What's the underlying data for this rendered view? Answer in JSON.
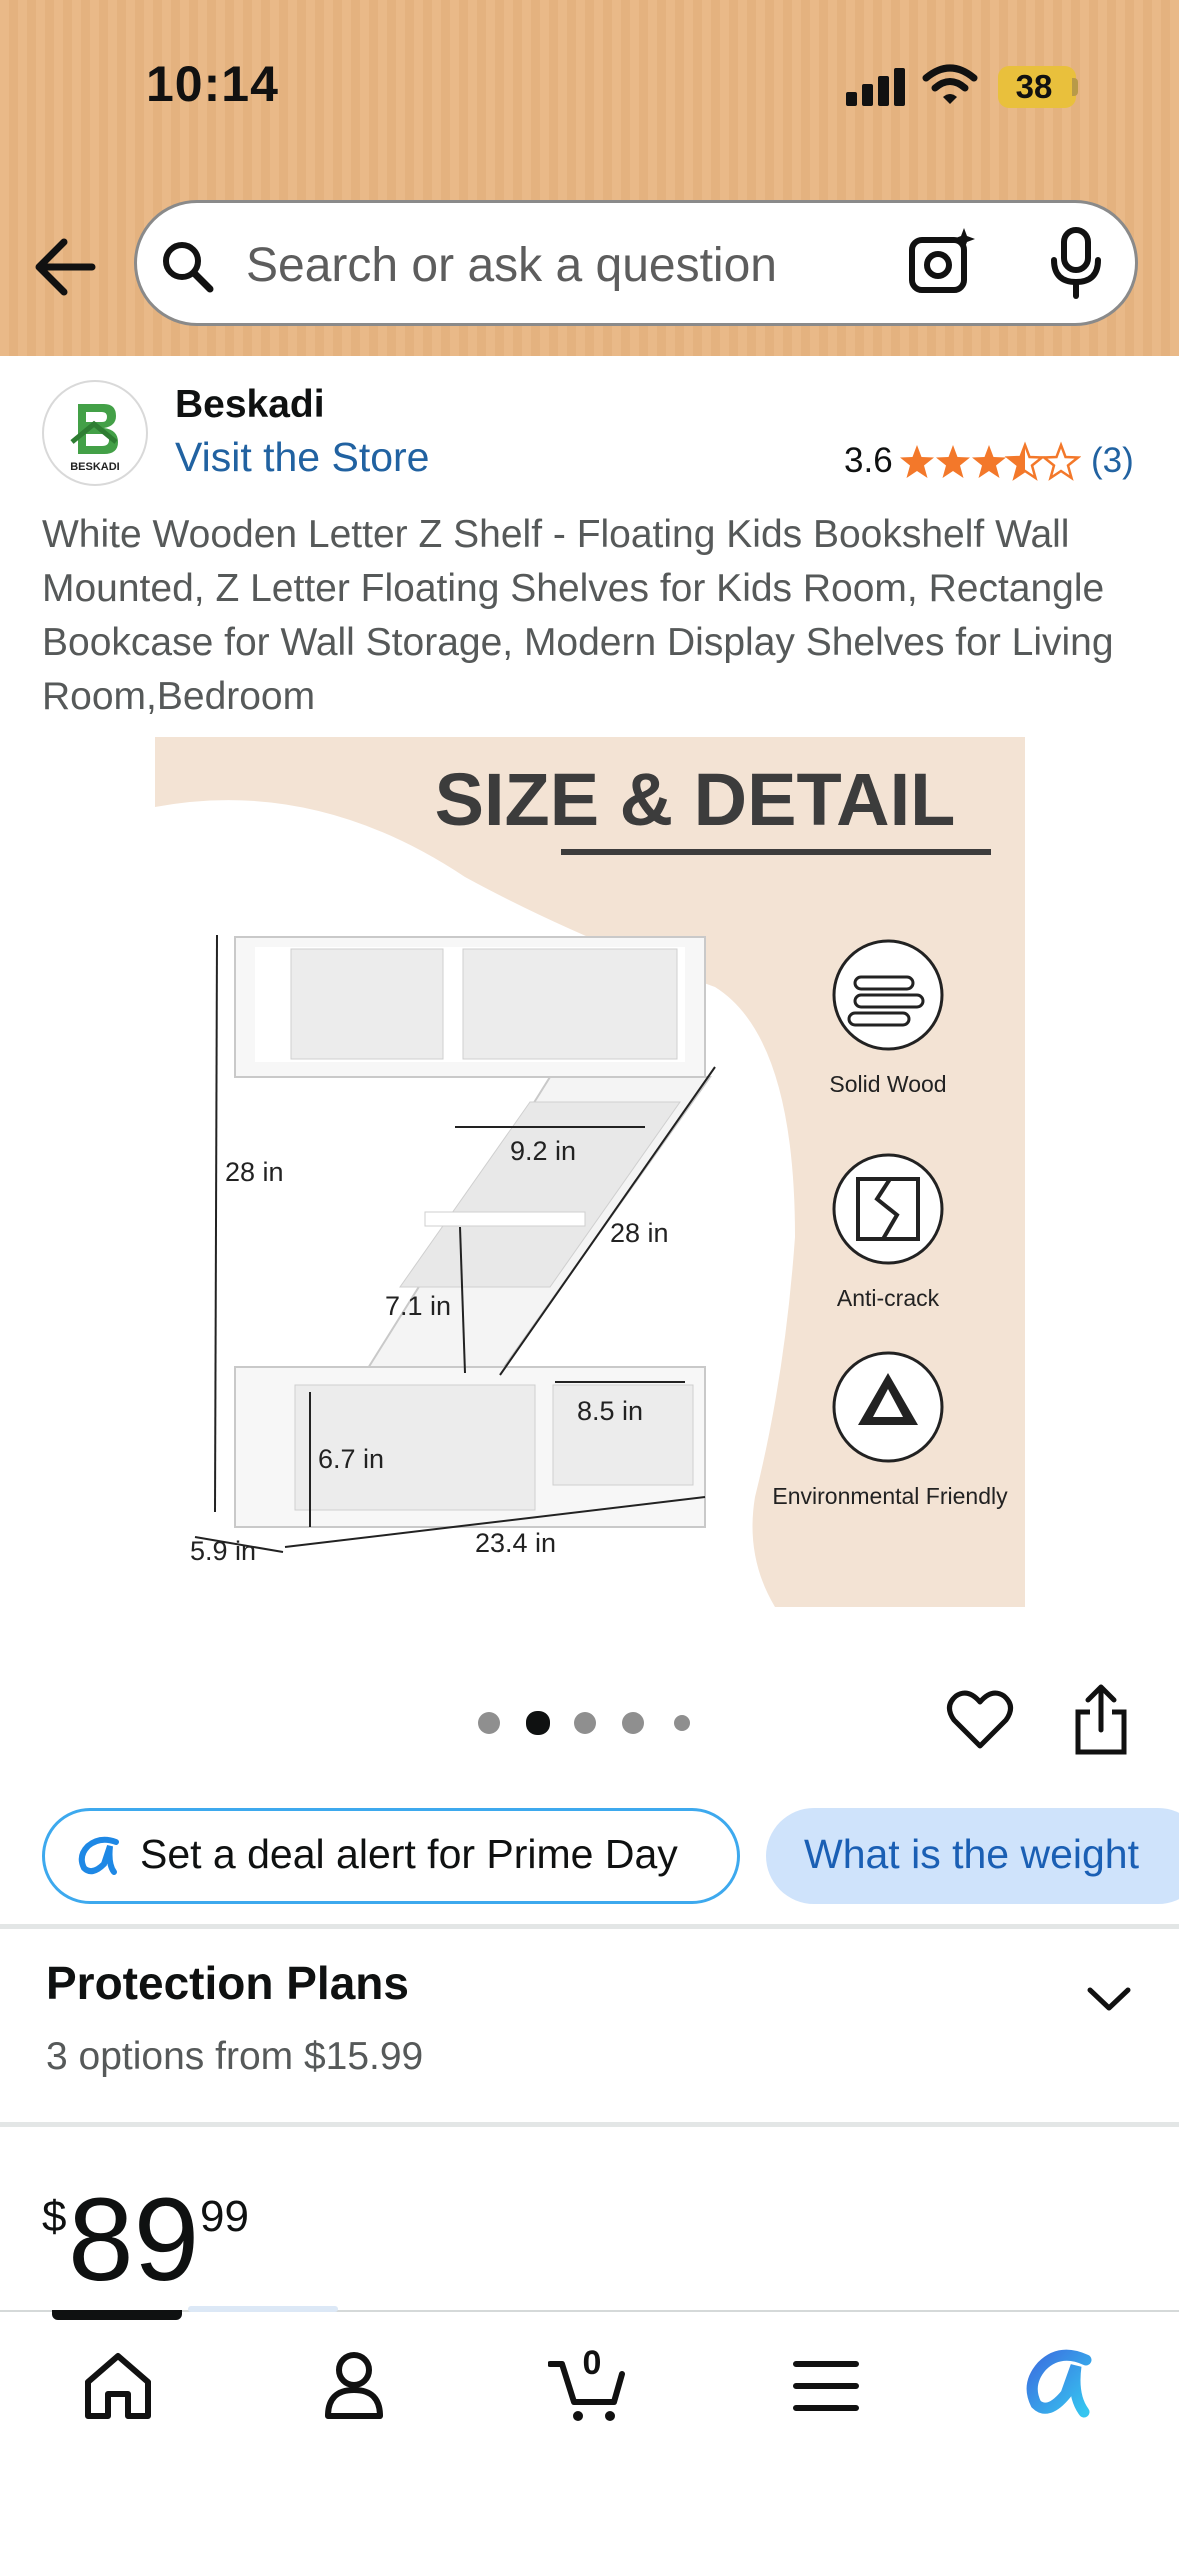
{
  "status_bar": {
    "time": "10:14",
    "battery": "38"
  },
  "search": {
    "placeholder": "Search or ask a question"
  },
  "store": {
    "brand": "Beskadi",
    "logo_text": "BESKADI",
    "visit_link": "Visit the Store",
    "rating": "3.6",
    "rating_value": 3.6,
    "rating_count": "(3)"
  },
  "product": {
    "title": "White Wooden Letter Z Shelf - Floating Kids Bookshelf Wall Mounted, Z Letter Floating Shelves for Kids Room, Rectangle Bookcase for Wall Storage, Modern Display Shelves for Living Room,Bedroom",
    "image": {
      "heading": "SIZE & DETAIL",
      "dimensions": {
        "height": "28 in",
        "top_width": "9.2 in",
        "diagonal": "28 in",
        "mid_height": "7.1 in",
        "right_width": "8.5 in",
        "bottom_height": "6.7 in",
        "depth": "5.9 in",
        "width": "23.4 in"
      },
      "features": [
        {
          "label": "Solid Wood",
          "icon": "wood-logs-icon"
        },
        {
          "label": "Anti-crack",
          "icon": "anti-crack-icon"
        },
        {
          "label": "Environmental Friendly",
          "icon": "eco-triangle-icon"
        }
      ]
    },
    "carousel": {
      "count": 5,
      "active_index": 1
    }
  },
  "chips": [
    {
      "label": "Set a deal alert for Prime Day"
    },
    {
      "label": "What is the weight"
    }
  ],
  "protection": {
    "title": "Protection Plans",
    "subtitle": "3 options from $15.99"
  },
  "price": {
    "symbol": "$",
    "whole": "89",
    "fraction": "99"
  },
  "tabs": [
    {
      "name": "home",
      "icon": "home-icon"
    },
    {
      "name": "account",
      "icon": "person-icon"
    },
    {
      "name": "cart",
      "icon": "cart-icon",
      "badge": "0"
    },
    {
      "name": "menu",
      "icon": "menu-icon"
    },
    {
      "name": "rufus",
      "icon": "rufus-icon"
    }
  ],
  "colors": {
    "topbar": "#e9b988",
    "link": "#2162a1",
    "star": "#f3782a",
    "chip_border": "#3da9ee",
    "chip_fill": "#cfe3fb",
    "image_bg": "#f3e3d4"
  }
}
